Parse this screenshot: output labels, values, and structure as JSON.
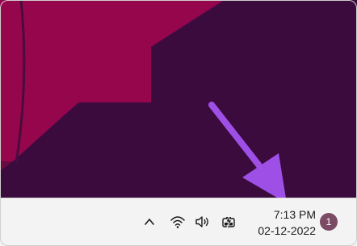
{
  "desktop": {
    "wallpaper_colors": {
      "background": "#3b0b3e",
      "shape": "#96064d",
      "shape_edge": "#6a0a3f",
      "shadow": "#4a0b45"
    },
    "annotation_arrow_color": "#9e4fe6"
  },
  "taskbar": {
    "background": "#f3f3f3",
    "tray_icons": [
      {
        "icon": "chevron-up-icon",
        "description": "Show hidden icons"
      },
      {
        "icon": "wifi-icon",
        "description": "Network"
      },
      {
        "icon": "speaker-icon",
        "description": "Volume"
      },
      {
        "icon": "battery-charging-icon",
        "description": "Battery"
      }
    ],
    "clock": {
      "time": "7:13 PM",
      "date": "02-12-2022"
    },
    "notification_count": "1",
    "notification_badge_color": "#7b4a64"
  }
}
